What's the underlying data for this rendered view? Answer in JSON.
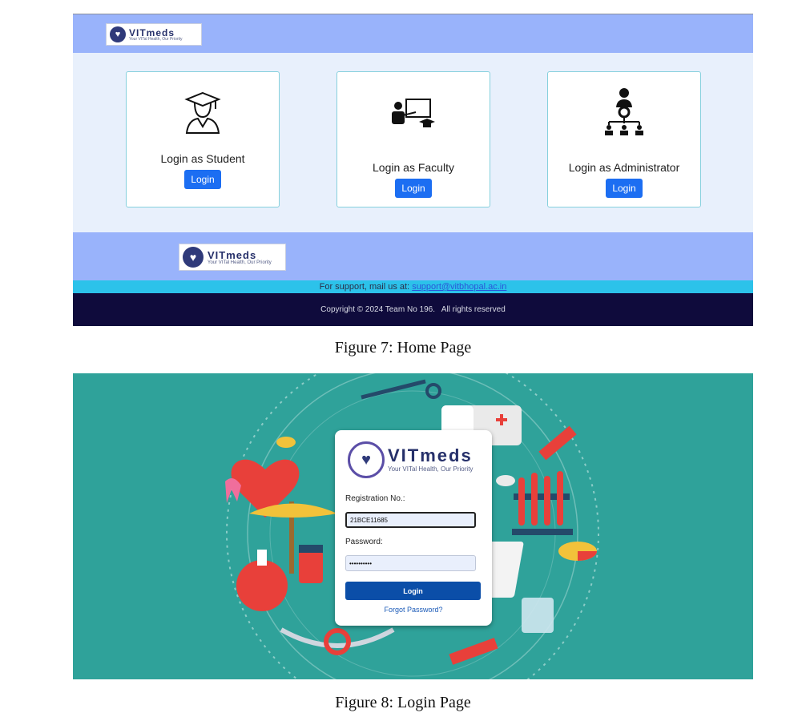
{
  "figure7": {
    "brand": {
      "name": "VITmeds",
      "tagline": "Your VITal Health, Our Priority"
    },
    "cards": [
      {
        "title": "Login as Student",
        "button": "Login",
        "icon": "graduate-icon"
      },
      {
        "title": "Login as Faculty",
        "button": "Login",
        "icon": "teacher-board-icon"
      },
      {
        "title": "Login as Administrator",
        "button": "Login",
        "icon": "admin-network-icon"
      }
    ],
    "footer": {
      "brand": {
        "name": "VITmeds",
        "tagline": "Your VITal Health, Our Priority"
      },
      "support_prefix": "For support, mail us at:",
      "support_email": "support@vitbhopal.ac.in",
      "copyright": "Copyright © 2024 Team No 196.   All rights reserved"
    },
    "caption": "Figure 7: Home Page"
  },
  "figure8": {
    "brand": {
      "name": "VITmeds",
      "tagline": "Your VITal Health, Our Priority"
    },
    "registration_label": "Registration No.:",
    "registration_value": "21BCE11685",
    "password_label": "Password:",
    "password_value": "••••••••••",
    "login_button": "Login",
    "forgot_link": "Forgot Password?",
    "caption": "Figure 8: Login Page"
  },
  "colors": {
    "header_blue": "#99b3fb",
    "body_bg": "#e8f0fc",
    "button_blue": "#1c6ef2",
    "support_bar": "#2cc2ea",
    "copyright_bar": "#0f0b3c",
    "login_bg_teal": "#2fa29a",
    "login_button": "#0b4ea8"
  }
}
